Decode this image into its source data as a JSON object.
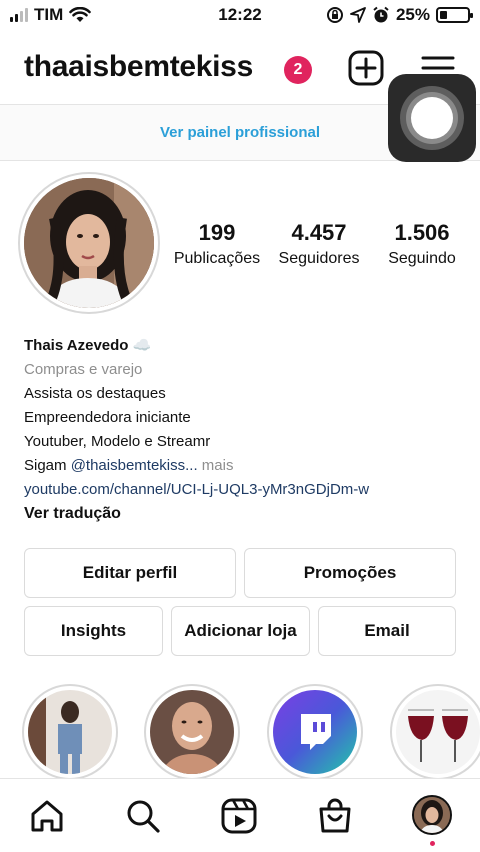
{
  "status_bar": {
    "carrier": "TIM",
    "time": "12:22",
    "battery_percent": "25%",
    "battery_level": 0.25
  },
  "header": {
    "username": "thaaisbemtekiss",
    "notification_count": "2",
    "icons": [
      "plus-square-icon",
      "menu-icon"
    ]
  },
  "professional_dashboard": {
    "label": "Ver painel profissional",
    "color": "#2b9fd8"
  },
  "profile": {
    "stats": [
      {
        "value": "199",
        "label": "Publicações"
      },
      {
        "value": "4.457",
        "label": "Seguidores"
      },
      {
        "value": "1.506",
        "label": "Seguindo"
      }
    ],
    "name": "Thais Azevedo ☁️",
    "category": "Compras e varejo",
    "bio_lines": [
      "Assista os destaques",
      "Empreendedora iniciante",
      "Youtuber, Modelo e Streamr"
    ],
    "bio_follow_prefix": "Sigam ",
    "bio_follow_handle": "@thaisbemtekiss...",
    "bio_more": "mais",
    "link": "youtube.com/channel/UCI-Lj-UQL3-yMr3nGDjDm-w",
    "translate": "Ver tradução"
  },
  "actions": {
    "edit_profile": "Editar perfil",
    "promotions": "Promoções",
    "insights": "Insights",
    "add_shop": "Adicionar loja",
    "email": "Email"
  },
  "highlights": [
    {
      "icon": "photo-thumbnail"
    },
    {
      "icon": "photo-thumbnail"
    },
    {
      "icon": "twitch-icon"
    },
    {
      "icon": "wine-glasses-icon"
    }
  ],
  "bottom_nav": [
    "home-icon",
    "search-icon",
    "reels-icon",
    "shop-icon",
    "profile-avatar"
  ],
  "colors": {
    "badge": "#e0245e",
    "link": "#1f3b64",
    "secondary_text": "#8e8e8e"
  }
}
